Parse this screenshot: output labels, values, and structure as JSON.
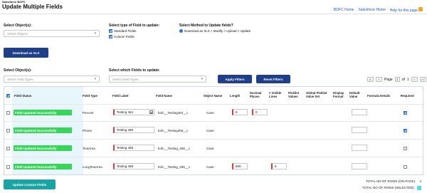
{
  "app": {
    "name": "Salesforce BOFC",
    "title": "Update Multiple Fields"
  },
  "top_links": {
    "bofc_home": "BOFC Home",
    "sf_home": "Salesforce Home",
    "help": "Help for this page"
  },
  "section1": {
    "objects_label": "Select Object(s):",
    "objects_placeholder": "Select Objects",
    "field_type_label": "Select type of Field to update:",
    "standard_fields": "Standard Fields",
    "custom_fields": "Custom Fields",
    "method_label": "Select Method to Update fields?",
    "method_option": "Download as XLS > Modify > Upload > Update",
    "download_button": "Download as XLS"
  },
  "section2": {
    "objects_label": "Select Object(s):",
    "field_types_placeholder": "Select Field Types",
    "fields_label": "Select which Fields to update:",
    "fields_placeholder": "Select Field Types",
    "apply_filters": "Apply Filters",
    "reset_filters": "Reset Filters"
  },
  "pager": {
    "first": "|<",
    "prev": "<",
    "page_label": "Page",
    "page": "1",
    "of_label": "of",
    "total_pages": "1",
    "next": ">",
    "last": ">>"
  },
  "table": {
    "headers": {
      "field_status": "Field Status",
      "field_type": "Field Type",
      "field_label": "Field Label",
      "field_name": "Field Name",
      "object_name": "Object Name",
      "length": "Length",
      "decimal_places": "Decimal Places",
      "visible_lines": "# Visible Lines",
      "picklist_values": "Picklist Values",
      "global_picklist": "Global Picklist Value Set",
      "display_format": "Display Format",
      "default_value": "Default Value",
      "formula_details": "Formula Details",
      "required": "Required"
    },
    "rows": [
      {
        "status": "Field Updated Successfully",
        "type": "Percent",
        "label": "Testing 464",
        "name": "bofc__Testing464__c",
        "object": "Case",
        "length": "5",
        "decimal": "0",
        "lines": "",
        "required": true
      },
      {
        "status": "Field Updated Successfully",
        "type": "Phone",
        "label": "Testing 465",
        "name": "bofc__Testing465__c",
        "object": "Case",
        "length": "",
        "decimal": "",
        "lines": "",
        "required": true
      },
      {
        "status": "Field Updated Successfully",
        "type": "TextArea",
        "label": "Testing 468",
        "name": "bofc__Testing_468__c",
        "object": "Case",
        "length": "",
        "decimal": "",
        "lines": "",
        "required": false
      },
      {
        "status": "Field Updated Successfully",
        "type": "LongTextArea",
        "label": "Testing 469",
        "name": "bofc__Testing_469__c",
        "object": "Case",
        "length": "500",
        "decimal": "",
        "lines": "5",
        "required": false
      }
    ]
  },
  "footer": {
    "update_button": "Update Custom Fields",
    "total_rows_label": "TOTAL NO OF ROWS (ON PAGE):",
    "total_rows": "4",
    "selected_label": "TOTAL NO OF ROWS (SELECTED):"
  },
  "colors": {
    "primary": "#1f3f8a",
    "teal": "#1aa3a3",
    "success": "#39d45a",
    "link": "#1a5bd6"
  }
}
